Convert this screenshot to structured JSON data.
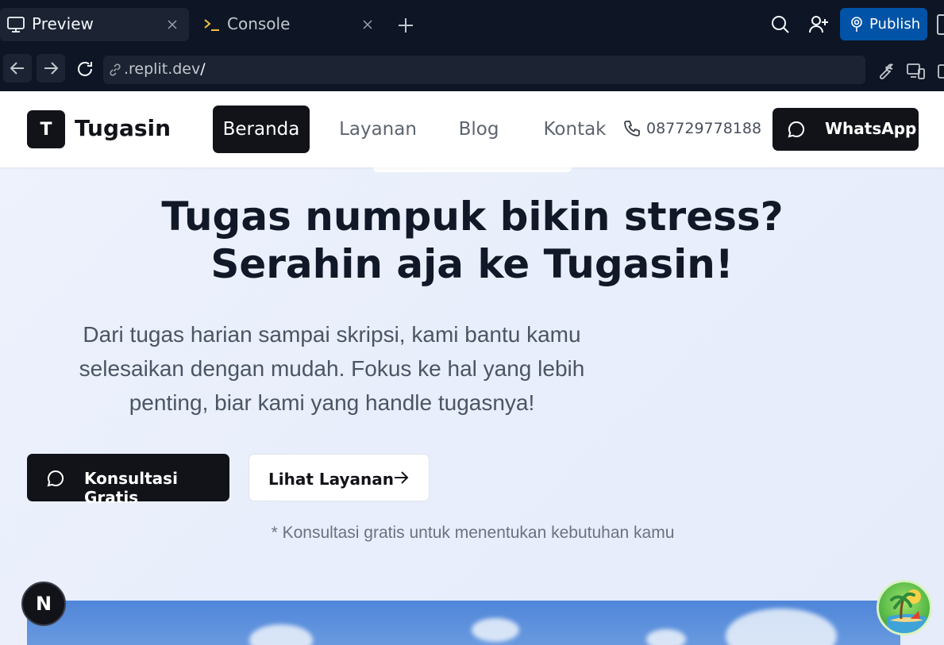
{
  "browser": {
    "tabs": [
      {
        "label": "Preview",
        "icon": "monitor-icon",
        "active": true
      },
      {
        "label": "Console",
        "icon": "terminal-icon",
        "active": false
      }
    ],
    "publish_label": "Publish",
    "url_prefix": ".replit.dev",
    "url_suffix": "/",
    "accent_color": "#0053a6"
  },
  "site": {
    "logo_letter": "T",
    "brand": "Tugasin",
    "nav": [
      "Beranda",
      "Layanan",
      "Blog",
      "Kontak"
    ],
    "active_nav": "Beranda",
    "phone": "087729778188",
    "whatsapp_label": "WhatsApp",
    "hero": {
      "title_line1": "Tugas numpuk bikin stress?",
      "title_line2": "Serahin aja ke Tugasin!",
      "subtitle": "Dari tugas harian sampai skripsi, kami bantu kamu selesaikan dengan mudah. Fokus ke hal yang lebih penting, biar kami yang handle tugasnya!",
      "cta_primary": "Konsultasi Gratis",
      "cta_secondary": "Lihat Layanan",
      "note": "* Konsultasi gratis untuk menentukan kebutuhan kamu"
    },
    "next_badge": "N"
  }
}
